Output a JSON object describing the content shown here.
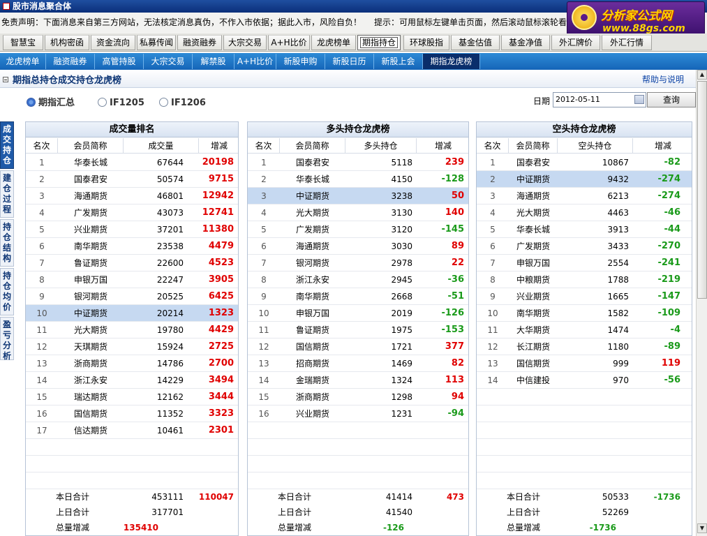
{
  "window": {
    "title": "股市消息聚合体"
  },
  "disclaimer": {
    "text": "免责声明：下面消息来自第三方网站，无法核定消息真伪，不作入市依据；据此入市，风险自负！",
    "hint": "提示：可用鼠标左键单击页面，然后滚动鼠标滚轮看全部内容"
  },
  "logo": {
    "line1": "分析家公式网",
    "line2": "www.88gs.com"
  },
  "top_tabs": [
    "智慧宝",
    "机构密函",
    "资金流向",
    "私募传闻",
    "融资融券",
    "大宗交易",
    "A+H比价",
    "龙虎榜单",
    "期指持仓",
    "环球股指",
    "基金估值",
    "基金净值",
    "外汇牌价",
    "外汇行情"
  ],
  "top_tabs_active": "期指持仓",
  "sub_tabs": [
    "龙虎榜单",
    "融资融券",
    "高管持股",
    "大宗交易",
    "解禁股",
    "A+H比价",
    "新股申购",
    "新股日历",
    "新股上会",
    "期指龙虎榜"
  ],
  "sub_tabs_active": "期指龙虎榜",
  "section": {
    "title": "期指总持仓成交持仓龙虎榜",
    "help": "帮助与说明"
  },
  "radios": [
    {
      "label": "期指汇总",
      "checked": true
    },
    {
      "label": "IF1205",
      "checked": false
    },
    {
      "label": "IF1206",
      "checked": false
    }
  ],
  "date": {
    "label": "日期",
    "value": "2012-05-11",
    "query": "查询"
  },
  "side_tabs": [
    {
      "label": "成交持仓",
      "active": true
    },
    {
      "label": "建仓过程",
      "active": false
    },
    {
      "label": "持仓结构",
      "active": false
    },
    {
      "label": "持仓均价",
      "active": false
    },
    {
      "label": "盈亏分析",
      "active": false
    }
  ],
  "panels": [
    {
      "title": "成交量排名",
      "headers": [
        "名次",
        "会员简称",
        "成交量",
        "增减"
      ],
      "selected_rank": 10,
      "rows": [
        [
          "1",
          "华泰长城",
          "67644",
          "20198"
        ],
        [
          "2",
          "国泰君安",
          "50574",
          "9715"
        ],
        [
          "3",
          "海通期货",
          "46801",
          "12942"
        ],
        [
          "4",
          "广发期货",
          "43073",
          "12741"
        ],
        [
          "5",
          "兴业期货",
          "37201",
          "11380"
        ],
        [
          "6",
          "南华期货",
          "23538",
          "4479"
        ],
        [
          "7",
          "鲁证期货",
          "22600",
          "4523"
        ],
        [
          "8",
          "申银万国",
          "22247",
          "3905"
        ],
        [
          "9",
          "银河期货",
          "20525",
          "6425"
        ],
        [
          "10",
          "中证期货",
          "20214",
          "1323"
        ],
        [
          "11",
          "光大期货",
          "19780",
          "4429"
        ],
        [
          "12",
          "天琪期货",
          "15924",
          "2725"
        ],
        [
          "13",
          "浙商期货",
          "14786",
          "2700"
        ],
        [
          "14",
          "浙江永安",
          "14229",
          "3494"
        ],
        [
          "15",
          "瑞达期货",
          "12162",
          "3444"
        ],
        [
          "16",
          "国信期货",
          "11352",
          "3323"
        ],
        [
          "17",
          "信达期货",
          "10461",
          "2301"
        ]
      ],
      "footer": [
        [
          "本日合计",
          "453111",
          "110047"
        ],
        [
          "上日合计",
          "317701",
          ""
        ],
        [
          "总量增减",
          "135410",
          ""
        ]
      ]
    },
    {
      "title": "多头持仓龙虎榜",
      "headers": [
        "名次",
        "会员简称",
        "多头持仓",
        "增减"
      ],
      "selected_rank": 3,
      "rows": [
        [
          "1",
          "国泰君安",
          "5118",
          "239"
        ],
        [
          "2",
          "华泰长城",
          "4150",
          "-128"
        ],
        [
          "3",
          "中证期货",
          "3238",
          "50"
        ],
        [
          "4",
          "光大期货",
          "3130",
          "140"
        ],
        [
          "5",
          "广发期货",
          "3120",
          "-145"
        ],
        [
          "6",
          "海通期货",
          "3030",
          "89"
        ],
        [
          "7",
          "银河期货",
          "2978",
          "22"
        ],
        [
          "8",
          "浙江永安",
          "2945",
          "-36"
        ],
        [
          "9",
          "南华期货",
          "2668",
          "-51"
        ],
        [
          "10",
          "申银万国",
          "2019",
          "-126"
        ],
        [
          "11",
          "鲁证期货",
          "1975",
          "-153"
        ],
        [
          "12",
          "国信期货",
          "1721",
          "377"
        ],
        [
          "13",
          "招商期货",
          "1469",
          "82"
        ],
        [
          "14",
          "金瑞期货",
          "1324",
          "113"
        ],
        [
          "15",
          "浙商期货",
          "1298",
          "94"
        ],
        [
          "16",
          "兴业期货",
          "1231",
          "-94"
        ]
      ],
      "footer": [
        [
          "本日合计",
          "41414",
          "473"
        ],
        [
          "上日合计",
          "41540",
          ""
        ],
        [
          "总量增减",
          "-126",
          ""
        ]
      ]
    },
    {
      "title": "空头持仓龙虎榜",
      "headers": [
        "名次",
        "会员简称",
        "空头持仓",
        "增减"
      ],
      "selected_rank": 2,
      "rows": [
        [
          "1",
          "国泰君安",
          "10867",
          "-82"
        ],
        [
          "2",
          "中证期货",
          "9432",
          "-274"
        ],
        [
          "3",
          "海通期货",
          "6213",
          "-274"
        ],
        [
          "4",
          "光大期货",
          "4463",
          "-46"
        ],
        [
          "5",
          "华泰长城",
          "3913",
          "-44"
        ],
        [
          "6",
          "广发期货",
          "3433",
          "-270"
        ],
        [
          "7",
          "申银万国",
          "2554",
          "-241"
        ],
        [
          "8",
          "中粮期货",
          "1788",
          "-219"
        ],
        [
          "9",
          "兴业期货",
          "1665",
          "-147"
        ],
        [
          "10",
          "南华期货",
          "1582",
          "-109"
        ],
        [
          "11",
          "大华期货",
          "1474",
          "-4"
        ],
        [
          "12",
          "长江期货",
          "1180",
          "-89"
        ],
        [
          "13",
          "国信期货",
          "999",
          "119"
        ],
        [
          "14",
          "中信建投",
          "970",
          "-56"
        ]
      ],
      "footer": [
        [
          "本日合计",
          "50533",
          "-1736"
        ],
        [
          "上日合计",
          "52269",
          ""
        ],
        [
          "总量增减",
          "-1736",
          ""
        ]
      ]
    }
  ]
}
